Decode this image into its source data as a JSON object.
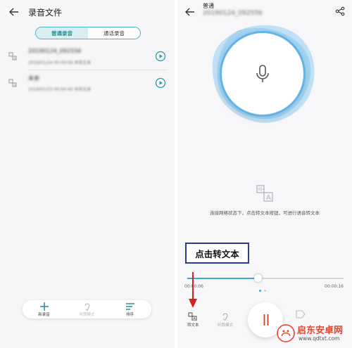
{
  "left": {
    "title": "录音文件",
    "tabs": [
      {
        "label": "普通录音",
        "active": true
      },
      {
        "label": "通话录音",
        "active": false
      }
    ],
    "recordings": [
      {
        "name": "20190124_092556",
        "meta": "2019/01/24  00:00:06  未转文本"
      },
      {
        "name": "未参",
        "meta": "2019/01/23  00:00:40  未转文本"
      }
    ],
    "bottom_bar": [
      {
        "label": "新录音",
        "icon": "plus-icon",
        "enabled": true
      },
      {
        "label": "听筒模式",
        "icon": "ear-icon",
        "enabled": false
      },
      {
        "label": "排序",
        "icon": "sort-icon",
        "enabled": true
      }
    ]
  },
  "right": {
    "title": "普通",
    "subtitle": "20190124_092556",
    "hint": "连接网络状态下，点击转文本按钮，可进行语音转文本",
    "callout": "点击转文本",
    "time_current": "00:00:06",
    "time_total": "00:00:16",
    "progress": 0.45,
    "controls": [
      {
        "label": "转文本",
        "icon": "speech-to-text-icon"
      },
      {
        "label": "听筒模式",
        "icon": "ear-icon"
      }
    ]
  },
  "watermark": {
    "text": "启东安卓网",
    "url": "www.qdtxt.com"
  },
  "colors": {
    "accent": "#3aa6d4",
    "tab_border": "#4fb6bf",
    "arrow": "#d62020",
    "callout_border": "#2b3d8f",
    "watermark": "#e8432f"
  }
}
